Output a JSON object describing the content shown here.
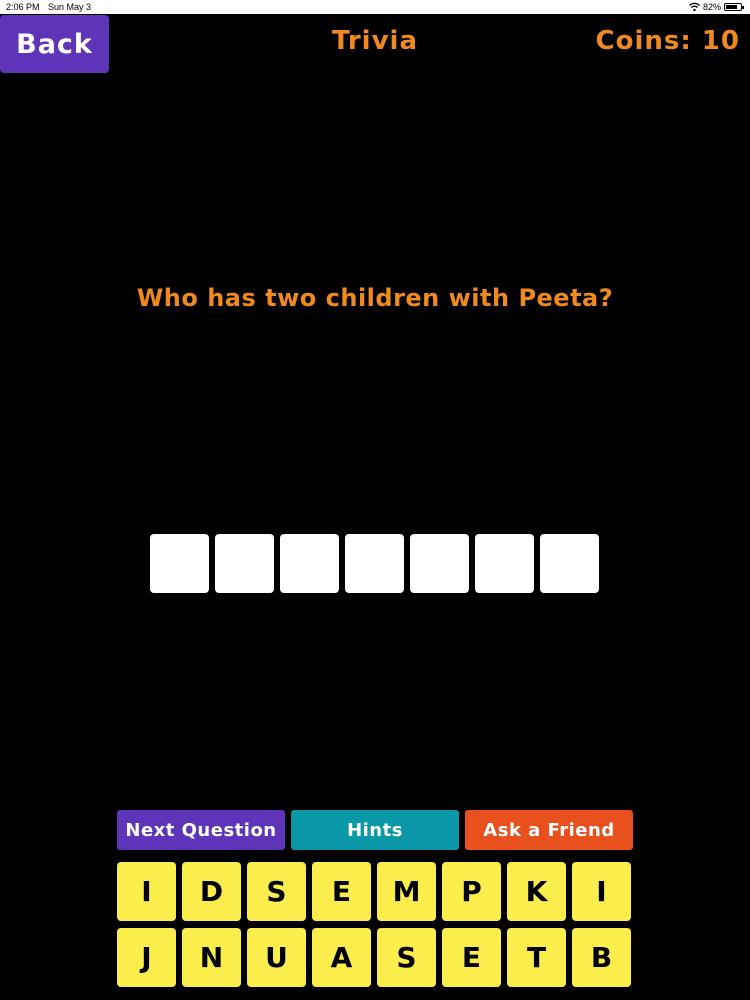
{
  "status_bar": {
    "time": "2:06 PM",
    "date": "Sun May 3",
    "battery": "82%",
    "battery_level": 0.82,
    "wifi_icon": "wifi-icon",
    "battery_icon": "battery-icon"
  },
  "header": {
    "back_label": "Back",
    "title": "Trivia",
    "coins_label": "Coins: 10"
  },
  "question": {
    "text": "Who has two children with Peeta?"
  },
  "answer": {
    "slot_count": 7
  },
  "actions": {
    "next_label": "Next Question",
    "hints_label": "Hints",
    "friend_label": "Ask a Friend"
  },
  "keyboard": {
    "letters": [
      "I",
      "D",
      "S",
      "E",
      "M",
      "P",
      "K",
      "I",
      "J",
      "N",
      "U",
      "A",
      "S",
      "E",
      "T",
      "B"
    ]
  },
  "colors": {
    "accent_orange": "#f08a1e",
    "purple": "#5e35b8",
    "teal": "#0a97a8",
    "red_orange": "#e8501e",
    "key_yellow": "#fbee4c",
    "background": "#000000"
  }
}
